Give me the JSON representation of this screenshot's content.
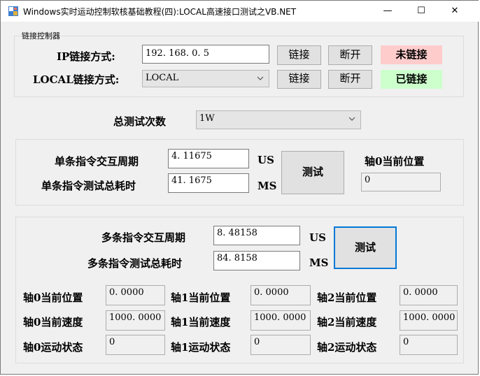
{
  "window": {
    "title": "Windows实时运动控制软核基础教程(四):LOCAL高速接口测试之VB.NET",
    "minimize": "—",
    "maximize": "☐",
    "close": "✕",
    "icon": "app-icon"
  },
  "connect_group": {
    "label": "链接控制器",
    "ip_label": "IP链接方式:",
    "ip_value": "192. 168. 0. 5",
    "ip_connect": "链接",
    "ip_disconnect": "断开",
    "ip_status": "未链接",
    "local_label": "LOCAL链接方式:",
    "local_value": "LOCAL",
    "local_connect": "链接",
    "local_disconnect": "断开",
    "local_status": "已链接",
    "status_colors": {
      "disconnected": "#ffcccc",
      "connected": "#ccffcc"
    }
  },
  "total_tests": {
    "label": "总测试次数",
    "value": "1W"
  },
  "single_group": {
    "cycle_label": "单条指令交互周期",
    "cycle_value": "4. 11675",
    "cycle_unit": "US",
    "total_label": "单条指令测试总耗时",
    "total_value": "41. 1675",
    "total_unit": "MS",
    "test_button": "测试",
    "axis_label": "轴0当前位置",
    "axis_value": "0"
  },
  "multi_group": {
    "cycle_label": "多条指令交互周期",
    "cycle_value": "8. 48158",
    "cycle_unit": "US",
    "total_label": "多条指令测试总耗时",
    "total_value": "84. 8158",
    "total_unit": "MS",
    "test_button": "测试",
    "axes": [
      {
        "pos_label": "轴0当前位置",
        "pos_value": "0. 0000",
        "speed_label": "轴0当前速度",
        "speed_value": "1000. 0000",
        "state_label": "轴0运动状态",
        "state_value": "0"
      },
      {
        "pos_label": "轴1当前位置",
        "pos_value": "0. 0000",
        "speed_label": "轴1当前速度",
        "speed_value": "1000. 0000",
        "state_label": "轴1运动状态",
        "state_value": "0"
      },
      {
        "pos_label": "轴2当前位置",
        "pos_value": "0. 0000",
        "speed_label": "轴2当前速度",
        "speed_value": "1000. 0000",
        "state_label": "轴2运动状态",
        "state_value": "0"
      }
    ]
  }
}
